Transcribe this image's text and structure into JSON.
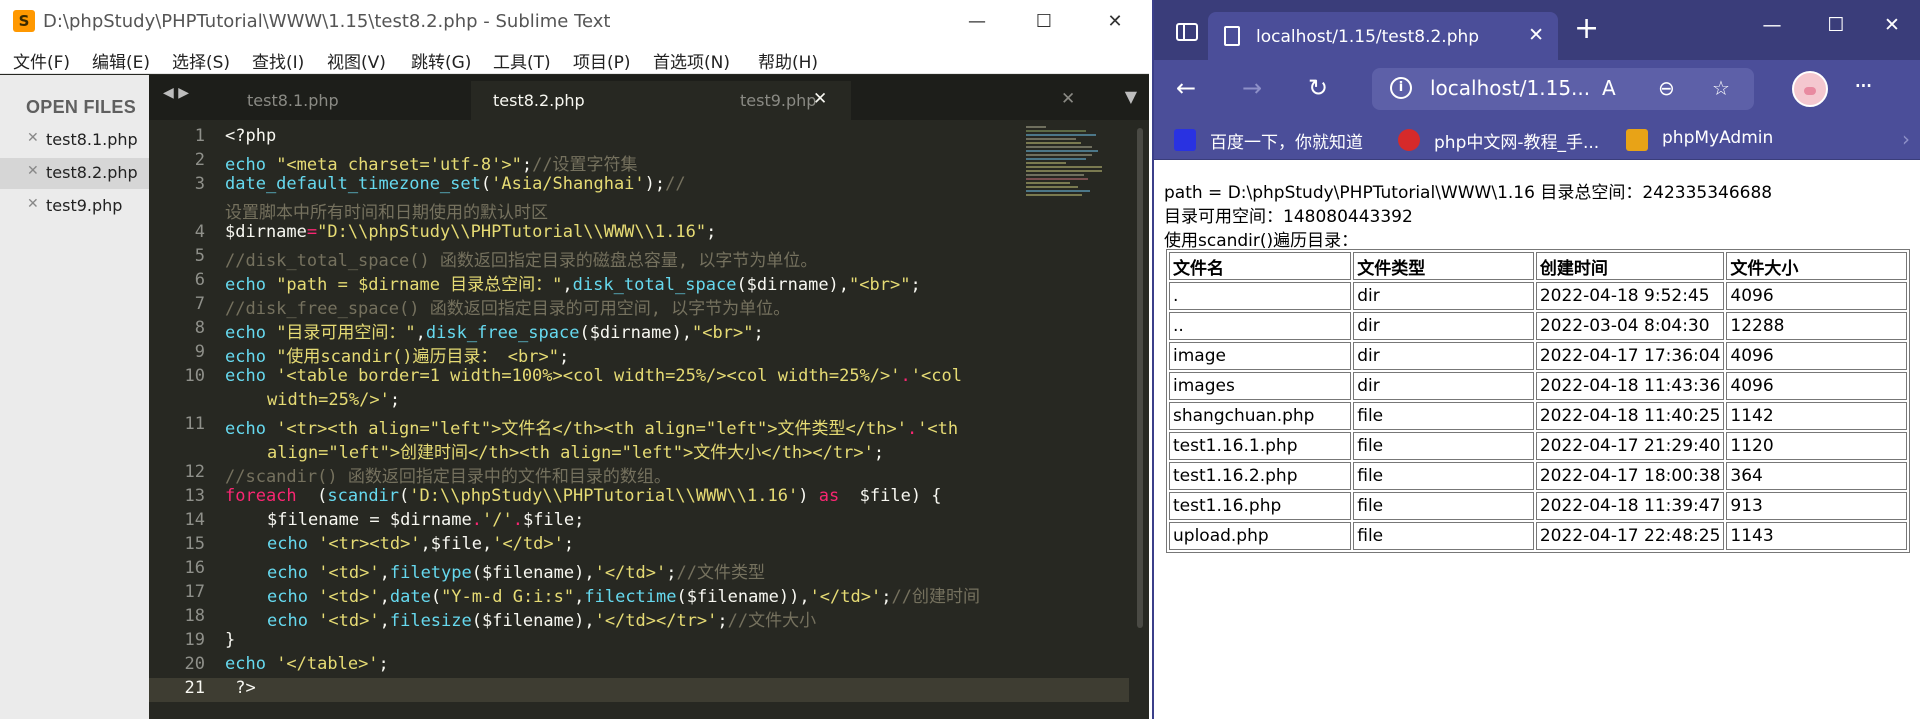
{
  "editor_window": {
    "title": "D:\\phpStudy\\PHPTutorial\\WWW\\1.15\\test8.2.php - Sublime Text",
    "logo": "S",
    "controls": {
      "minimize": "—",
      "maximize": "☐",
      "close": "✕"
    },
    "menu": [
      "文件(F)",
      "编辑(E)",
      "选择(S)",
      "查找(I)",
      "视图(V)",
      "跳转(G)",
      "工具(T)",
      "项目(P)",
      "首选项(N)",
      "帮助(H)"
    ],
    "sidebar": {
      "header": "OPEN FILES",
      "files": [
        {
          "name": "test8.1.php",
          "close": "✕"
        },
        {
          "name": "test8.2.php",
          "close": "✕"
        },
        {
          "name": "test9.php",
          "close": "✕"
        }
      ]
    },
    "tabs": [
      {
        "label": "test8.1.php",
        "close": "✕"
      },
      {
        "label": "test8.2.php",
        "close": "✕"
      },
      {
        "label": "test9.php",
        "close": "✕"
      }
    ],
    "tab_nav": "◀ ▶",
    "tab_dropdown": "▼",
    "line_numbers": [
      "1",
      "2",
      "3",
      "4",
      "5",
      "6",
      "7",
      "8",
      "9",
      "10",
      "11",
      "12",
      "13",
      "14",
      "15",
      "16",
      "17",
      "18",
      "19",
      "20",
      "21"
    ],
    "code": {
      "l1": "<?php",
      "l2a": "echo ",
      "l2b": "\"<meta charset='utf-8'>\"",
      "l2c": ";",
      "l2d": "//设置字符集",
      "l3a": "date_default_timezone_set",
      "l3b": "(",
      "l3c": "'Asia/Shanghai'",
      "l3d": ");",
      "l3e": "//",
      "l3w": "设置脚本中所有时间和日期使用的默认时区",
      "l4a": "$dirname",
      "l4b": "=",
      "l4c": "\"D:\\\\phpStudy\\\\PHPTutorial\\\\WWW\\\\1.16\"",
      "l4d": ";",
      "l5": "//disk_total_space() 函数返回指定目录的磁盘总容量, 以字节为单位。",
      "l6a": "echo ",
      "l6b": "\"path = $dirname 目录总空间：\"",
      "l6c": ",",
      "l6d": "disk_total_space",
      "l6e": "($dirname),",
      "l6f": "\"<br>\"",
      "l6g": ";",
      "l7": "//disk_free_space() 函数返回指定目录的可用空间, 以字节为单位。",
      "l8a": "echo ",
      "l8b": "\"目录可用空间：\"",
      "l8c": ",",
      "l8d": "disk_free_space",
      "l8e": "($dirname),",
      "l8f": "\"<br>\"",
      "l8g": ";",
      "l9a": "echo ",
      "l9b": "\"使用scandir()遍历目录： <br>\"",
      "l9c": ";",
      "l10a": "echo ",
      "l10b": "'<table border=1 width=100%><col width=25%/><col width=25%/>'",
      "l10c": ".",
      "l10d": "'<col",
      "l10w": "width=25%/>'",
      "l10x": ";",
      "l11a": "echo ",
      "l11b": "'<tr><th align=\"left\">文件名</th><th align=\"left\">文件类型</th>'",
      "l11c": ".",
      "l11d": "'<th",
      "l11w": "align=\"left\">创建时间</th><th align=\"left\">文件大小</th></tr>'",
      "l11x": ";",
      "l12": "//scandir() 函数返回指定目录中的文件和目录的数组。",
      "l13a": "foreach",
      "l13b": "  (",
      "l13c": "scandir",
      "l13d": "(",
      "l13e": "'D:\\\\phpStudy\\\\PHPTutorial\\\\WWW\\\\1.16'",
      "l13f": ") ",
      "l13g": "as",
      "l13h": "  $file) {",
      "l14a": "$filename",
      "l14b": " = ",
      "l14c": "$dirname",
      "l14d": ".",
      "l14e": "'/'",
      "l14f": ".",
      "l14g": "$file;",
      "l15a": "echo ",
      "l15b": "'<tr><td>'",
      "l15c": ",$file,",
      "l15d": "'</td>'",
      "l15e": ";",
      "l16a": "echo ",
      "l16b": "'<td>'",
      "l16c": ",",
      "l16d": "filetype",
      "l16e": "($filename),",
      "l16f": "'</td>'",
      "l16g": ";",
      "l16h": "//文件类型",
      "l17a": "echo ",
      "l17b": "'<td>'",
      "l17c": ",",
      "l17d": "date",
      "l17e": "(",
      "l17f": "\"Y-m-d G:i:s\"",
      "l17g": ",",
      "l17h": "filectime",
      "l17i": "($filename)),",
      "l17j": "'</td>'",
      "l17k": ";",
      "l17l": "//创建时间",
      "l18a": "echo ",
      "l18b": "'<td>'",
      "l18c": ",",
      "l18d": "filesize",
      "l18e": "($filename),",
      "l18f": "'</td></tr>'",
      "l18g": ";",
      "l18h": "//文件大小",
      "l19": "}",
      "l20a": "echo ",
      "l20b": "'</table>'",
      "l20c": ";",
      "l21": " ?>"
    },
    "colors": {
      "background": "#272822",
      "keyword": "#66d9ef",
      "string": "#e6db74",
      "comment": "#75715e",
      "operator": "#f92672"
    }
  },
  "browser_window": {
    "tab_title": "localhost/1.15/test8.2.php",
    "tab_close": "✕",
    "new_tab": "+",
    "controls": {
      "minimize": "—",
      "maximize": "☐",
      "close": "✕"
    },
    "toolbar": {
      "back": "←",
      "forward": "→",
      "refresh": "↻",
      "url": "localhost/1.15...",
      "info": "i",
      "read_aloud": "A",
      "zoom": "⊖",
      "favorite": "☆",
      "more": "···"
    },
    "bookmarks": [
      {
        "label": "百度一下，你就知道",
        "color": "#2932e1"
      },
      {
        "label": "php中文网-教程_手...",
        "color": "#d62a2a"
      },
      {
        "label": "phpMyAdmin",
        "color": "#e8a317"
      }
    ],
    "bookmarks_overflow": "›",
    "page": {
      "line1": "path = D:\\phpStudy\\PHPTutorial\\WWW\\1.16 目录总空间：242335346688",
      "line2": "目录可用空间：148080443392",
      "line3": "使用scandir()遍历目录：",
      "table": {
        "headers": [
          "文件名",
          "文件类型",
          "创建时间",
          "文件大小"
        ],
        "rows": [
          [
            ".",
            "dir",
            "2022-04-18 9:52:45",
            "4096"
          ],
          [
            "..",
            "dir",
            "2022-03-04 8:04:30",
            "12288"
          ],
          [
            "image",
            "dir",
            "2022-04-17 17:36:04",
            "4096"
          ],
          [
            "images",
            "dir",
            "2022-04-18 11:43:36",
            "4096"
          ],
          [
            "shangchuan.php",
            "file",
            "2022-04-18 11:40:25",
            "1142"
          ],
          [
            "test1.16.1.php",
            "file",
            "2022-04-17 21:29:40",
            "1120"
          ],
          [
            "test1.16.2.php",
            "file",
            "2022-04-17 18:00:38",
            "364"
          ],
          [
            "test1.16.php",
            "file",
            "2022-04-18 11:39:47",
            "913"
          ],
          [
            "upload.php",
            "file",
            "2022-04-17 22:48:25",
            "1143"
          ]
        ]
      }
    }
  }
}
